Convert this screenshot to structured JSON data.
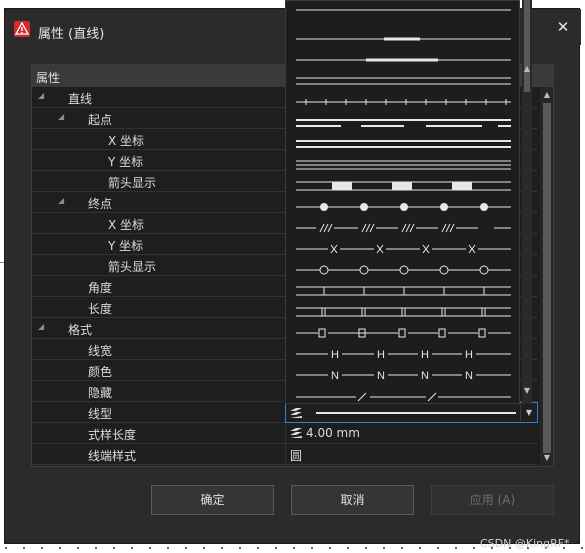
{
  "window": {
    "title": "属性 (直线)"
  },
  "grid": {
    "header": "属性",
    "rows": [
      {
        "label": "直线",
        "indent": 1,
        "toggle": "expanded",
        "value": ""
      },
      {
        "label": "起点",
        "indent": 2,
        "toggle": "expanded",
        "value": ""
      },
      {
        "label": "X 坐标",
        "indent": 3,
        "toggle": "",
        "value": ""
      },
      {
        "label": "Y 坐标",
        "indent": 3,
        "toggle": "",
        "value": ""
      },
      {
        "label": "箭头显示",
        "indent": 3,
        "toggle": "",
        "value": ""
      },
      {
        "label": "终点",
        "indent": 2,
        "toggle": "expanded",
        "value": ""
      },
      {
        "label": "X 坐标",
        "indent": 3,
        "toggle": "",
        "value": ""
      },
      {
        "label": "Y 坐标",
        "indent": 3,
        "toggle": "",
        "value": ""
      },
      {
        "label": "箭头显示",
        "indent": 3,
        "toggle": "",
        "value": ""
      },
      {
        "label": "角度",
        "indent": 2,
        "toggle": "",
        "value": ""
      },
      {
        "label": "长度",
        "indent": 2,
        "toggle": "",
        "value": ""
      },
      {
        "label": "格式",
        "indent": 1,
        "toggle": "expanded",
        "value": ""
      },
      {
        "label": "线宽",
        "indent": 2,
        "toggle": "",
        "value": ""
      },
      {
        "label": "颜色",
        "indent": 2,
        "toggle": "",
        "value": ""
      },
      {
        "label": "隐藏",
        "indent": 2,
        "toggle": "",
        "value": ""
      },
      {
        "label": "线型",
        "indent": 2,
        "toggle": "",
        "value": ""
      },
      {
        "label": "式样长度",
        "indent": 2,
        "toggle": "",
        "value": "4.00 mm"
      },
      {
        "label": "线端样式",
        "indent": 2,
        "toggle": "",
        "value": "圆"
      }
    ]
  },
  "linetype_dropdown": {
    "options": [
      {
        "style": "solid-short"
      },
      {
        "style": "dash-long-gap"
      },
      {
        "style": "dash-long"
      },
      {
        "style": "double-thin"
      },
      {
        "style": "tick-marks"
      },
      {
        "style": "double-dash"
      },
      {
        "style": "double-solid"
      },
      {
        "style": "triple-thin"
      },
      {
        "style": "block-segments"
      },
      {
        "style": "dots"
      },
      {
        "style": "triple-slash"
      },
      {
        "style": "x-marks"
      },
      {
        "style": "circles"
      },
      {
        "style": "tick-down"
      },
      {
        "style": "double-tick"
      },
      {
        "style": "small-rect"
      },
      {
        "style": "letter-H",
        "glyph": "H"
      },
      {
        "style": "letter-N",
        "glyph": "N"
      },
      {
        "style": "slash-gap"
      }
    ]
  },
  "buttons": {
    "ok": "确定",
    "cancel": "取消",
    "apply": "应用 (A)"
  },
  "watermark": "CSDN @KingRF*",
  "colors": {
    "accent": "#2f7fd6",
    "app_icon": "#d62b2b",
    "background": "#2b2b2b"
  }
}
